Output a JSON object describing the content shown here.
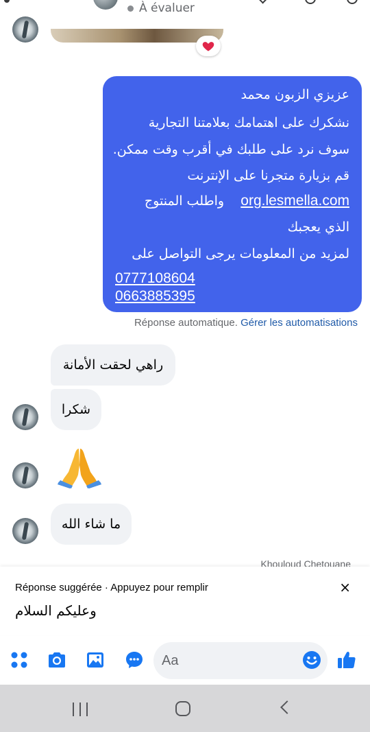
{
  "header": {
    "status": "À évaluer"
  },
  "reaction": {
    "emoji": "heart"
  },
  "auto_reply": {
    "lines": [
      "عزيزي الزبون محمد",
      "نشكرك على اهتمامك بعلامتنا التجارية",
      "سوف نرد على طلبك في أقرب وقت ممكن.",
      "قم بزيارة متجرنا على الإنترنت",
      "واطلب المنتوج",
      "الذي يعجبك",
      "لمزيد من المعلومات يرجى التواصل على"
    ],
    "link": "org.lesmella.com",
    "phones": [
      "0777108604",
      "0663885395"
    ],
    "note": "Réponse automatique.",
    "manage": "Gérer les automatisations"
  },
  "messages": [
    {
      "text": "راهي لحقت الأمانة"
    },
    {
      "text": "شكرا"
    },
    {
      "text": "🙏"
    },
    {
      "text": "ما شاء الله"
    }
  ],
  "seen_by": "Khouloud Chetouane",
  "suggestion": {
    "header": "Réponse suggérée · Appuyez pour remplir",
    "close": "×",
    "reply": "وعليكم السلام"
  },
  "composer": {
    "placeholder": "Aa",
    "icons": [
      "menu-dots-icon",
      "camera-icon",
      "gallery-icon",
      "chat-bubble-icon",
      "emoji-icon",
      "thumbs-up-icon"
    ],
    "accent": "#1877f2"
  },
  "colors": {
    "bubble_blue": "#4263eb",
    "bubble_gray": "#f0f2f5",
    "link": "#1f5aa8"
  }
}
